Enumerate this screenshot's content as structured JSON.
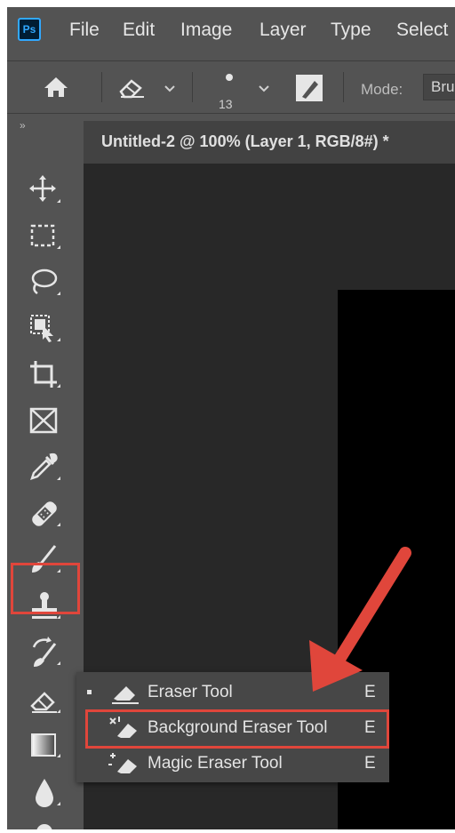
{
  "menubar": {
    "logo": "Ps",
    "items": [
      "File",
      "Edit",
      "Image",
      "Layer",
      "Type",
      "Select"
    ]
  },
  "options": {
    "brush_size": "13",
    "mode_label": "Mode:",
    "mode_value": "Bru"
  },
  "toolbar": {
    "collapse_glyph": "»"
  },
  "document": {
    "tab_title": "Untitled-2 @ 100% (Layer 1, RGB/8#) *"
  },
  "flyout": {
    "items": [
      {
        "label": "Eraser Tool",
        "shortcut": "E"
      },
      {
        "label": "Background Eraser Tool",
        "shortcut": "E"
      },
      {
        "label": "Magic Eraser Tool",
        "shortcut": "E"
      }
    ]
  },
  "colors": {
    "highlight": "#e0463b",
    "ui_bg": "#535353",
    "canvas_bg": "#282828"
  }
}
